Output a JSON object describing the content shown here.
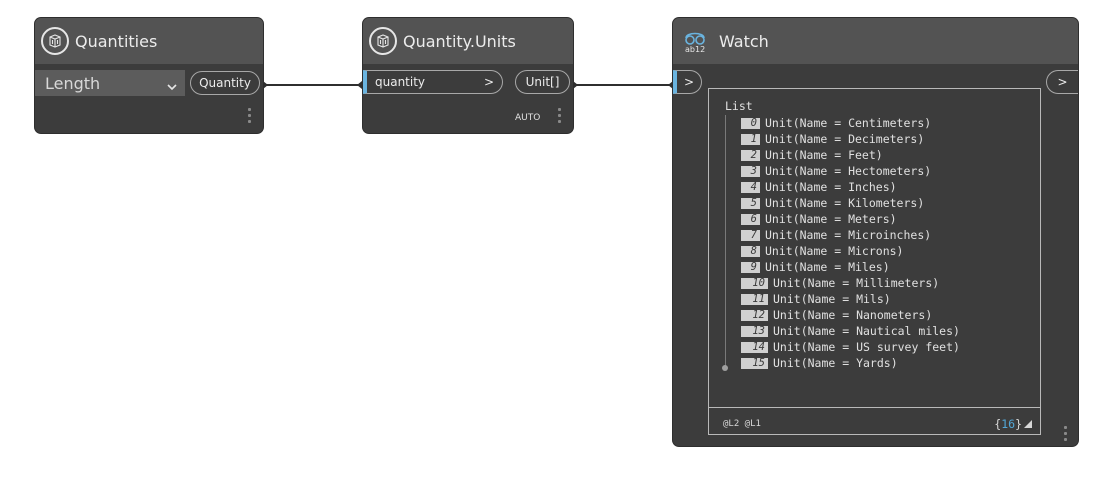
{
  "nodes": {
    "quantities": {
      "title": "Quantities",
      "dropdown_value": "Length",
      "output_port": "Quantity"
    },
    "quantity_units": {
      "title": "Quantity.Units",
      "input_port": "quantity",
      "input_chevron": ">",
      "output_port": "Unit[]",
      "lacing": "AUTO"
    },
    "watch": {
      "title": "Watch",
      "input_chevron": ">",
      "output_chevron": ">",
      "list_label": "List",
      "items": [
        {
          "index": "0",
          "text": "Unit(Name = Centimeters)"
        },
        {
          "index": "1",
          "text": "Unit(Name = Decimeters)"
        },
        {
          "index": "2",
          "text": "Unit(Name = Feet)"
        },
        {
          "index": "3",
          "text": "Unit(Name = Hectometers)"
        },
        {
          "index": "4",
          "text": "Unit(Name = Inches)"
        },
        {
          "index": "5",
          "text": "Unit(Name = Kilometers)"
        },
        {
          "index": "6",
          "text": "Unit(Name = Meters)"
        },
        {
          "index": "7",
          "text": "Unit(Name = Microinches)"
        },
        {
          "index": "8",
          "text": "Unit(Name = Microns)"
        },
        {
          "index": "9",
          "text": "Unit(Name = Miles)"
        },
        {
          "index": "10",
          "text": "Unit(Name = Millimeters)"
        },
        {
          "index": "11",
          "text": "Unit(Name = Mils)"
        },
        {
          "index": "12",
          "text": "Unit(Name = Nanometers)"
        },
        {
          "index": "13",
          "text": "Unit(Name = Nautical miles)"
        },
        {
          "index": "14",
          "text": "Unit(Name = US survey feet)"
        },
        {
          "index": "15",
          "text": "Unit(Name = Yards)"
        }
      ],
      "levels": "@L2 @L1",
      "count_open": "{",
      "count_value": "16",
      "count_close": "}"
    }
  },
  "icons": {
    "node_icon": "dynamo-node-icon",
    "watch_icon": "watch-glasses-icon",
    "resize_icon": "resize-corner-icon"
  },
  "colors": {
    "node_header": "#535353",
    "node_body": "#3c3c3c",
    "port_active": "#6ab4e0",
    "count_accent": "#53a8d8"
  }
}
